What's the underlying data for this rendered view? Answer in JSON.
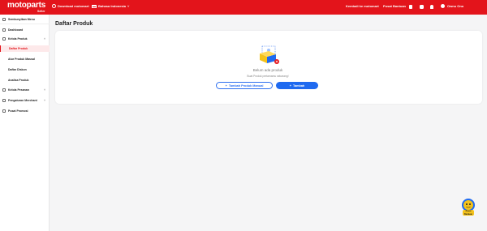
{
  "app": {
    "logo_text": "motoparts",
    "logo_sub": "Seller",
    "brand_color": "#e3141b",
    "accent_color": "#1f6af0"
  },
  "topbar": {
    "download_label": "Download motomart",
    "language_label": "Bahasa Indonesia",
    "back_label": "Kembali ke motomart",
    "help_label": "Pusat Bantuan",
    "user_name": "Ownu Ono",
    "icons": [
      "phone-icon",
      "flag-icon",
      "chevron-down-icon",
      "clipboard-icon",
      "chat-icon",
      "bell-icon",
      "avatar"
    ]
  },
  "sidebar": {
    "collapse_label": "Sembunyikan Menu",
    "items": [
      {
        "label": "Dashboard",
        "icon": "home-icon"
      },
      {
        "label": "Kelola Produk",
        "icon": "box-icon",
        "chevron": "˄"
      },
      {
        "label": "Daftar Produk",
        "active": true
      },
      {
        "label": "Atur Produk Massal"
      },
      {
        "label": "Daftar Diskon"
      },
      {
        "label": "Analisa Produk"
      },
      {
        "label": "Kelola Pesanan",
        "icon": "cart-icon",
        "chevron": "˅"
      },
      {
        "label": "Pengaturan Merchant",
        "icon": "store-icon",
        "chevron": "˅"
      },
      {
        "label": "Pusat Promosi",
        "icon": "megaphone-icon"
      }
    ]
  },
  "main": {
    "title": "Daftar Produk",
    "empty_title": "Belum ada produk",
    "empty_subtitle": "Buat Produk pertamamu sekarang!",
    "btn_manual": "Tambah Produk Manual",
    "btn_add": "Tambah",
    "btn_icon": "+"
  },
  "floating": {
    "help_label": "Pusat Bantuan"
  }
}
